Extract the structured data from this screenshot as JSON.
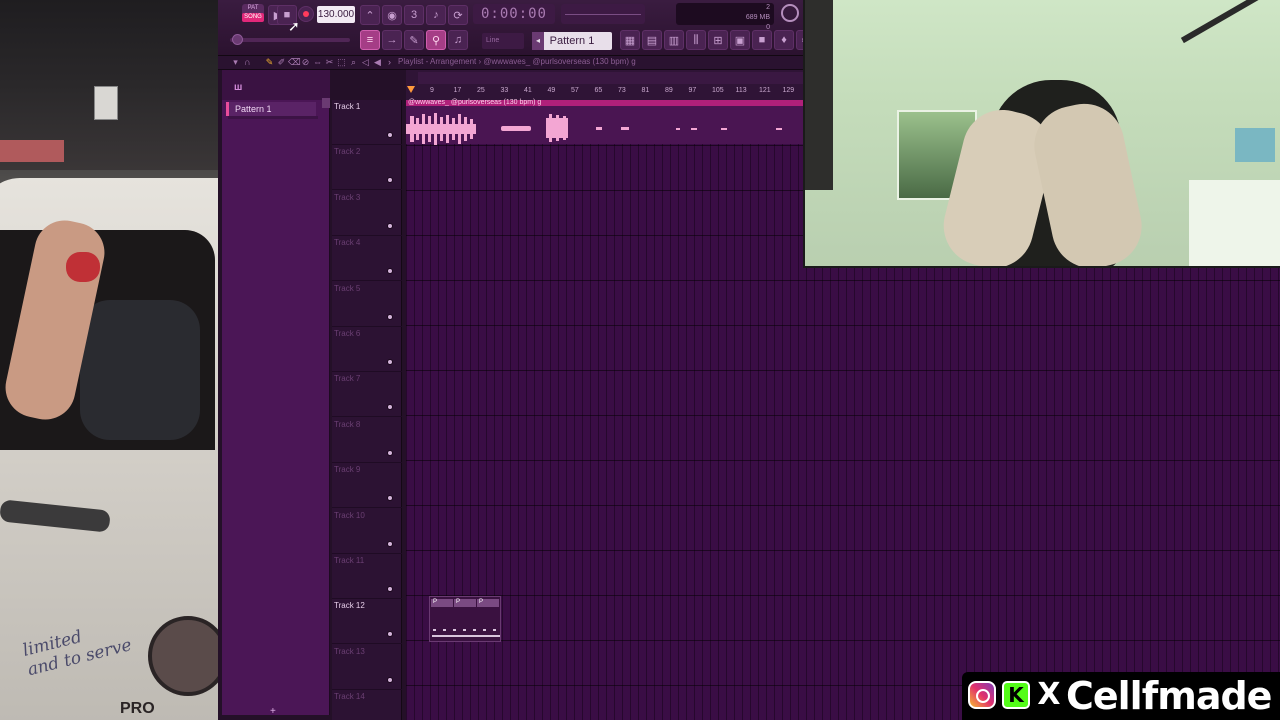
{
  "cam_left": {
    "car_text": "limited\nand to serve",
    "car_text2": "PRO"
  },
  "toolbar": {
    "pat_label": "PAT",
    "song_label": "SONG",
    "tempo": "130.000",
    "timer": "0:00:00",
    "cpu_line1": "2",
    "cpu_line2": "689 MB",
    "cpu_line3": "0",
    "snap": "Line",
    "pattern": "Pattern 1"
  },
  "playlist": {
    "title": "Playlist - Arrangement › @wwwaves_ @purlsoverseas (130 bpm) g"
  },
  "picker": {
    "item": "Pattern 1",
    "add": "+"
  },
  "ruler": {
    "ticks": [
      "9",
      "17",
      "25",
      "33",
      "41",
      "49",
      "57",
      "65",
      "73",
      "81",
      "89",
      "97",
      "105",
      "113",
      "121",
      "129"
    ]
  },
  "tracks": [
    "Track 1",
    "Track 2",
    "Track 3",
    "Track 4",
    "Track 5",
    "Track 6",
    "Track 7",
    "Track 8",
    "Track 9",
    "Track 10",
    "Track 11",
    "Track 12",
    "Track 13",
    "Track 14"
  ],
  "clips": {
    "audio_label": "@wwwaves_ @purlsoverseas (130 bpm) g",
    "pattern_seg_label": "P"
  },
  "social": {
    "handle": "Cellfmade",
    "kick_letter": "K",
    "x_letter": "X"
  },
  "colors": {
    "accent": "#e2287a",
    "grid_bg": "#3a0d45",
    "waveform": "#f3a6d3"
  }
}
